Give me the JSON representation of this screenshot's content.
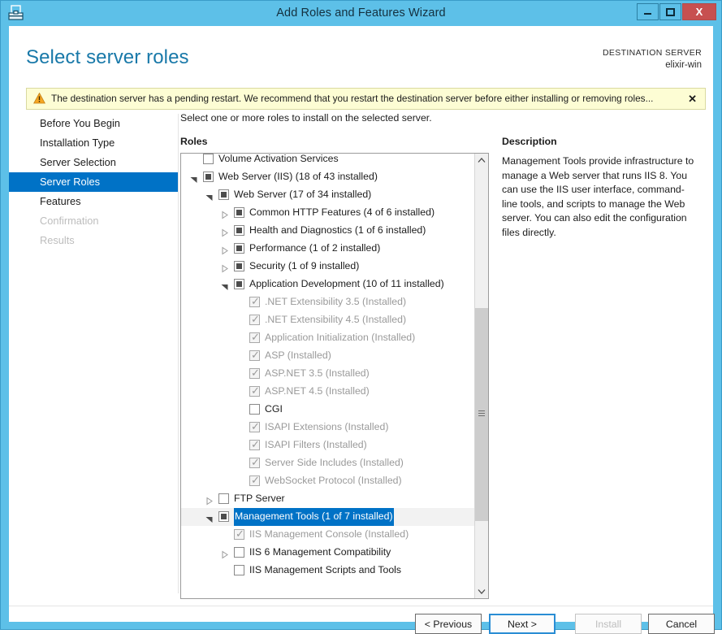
{
  "window": {
    "title": "Add Roles and Features Wizard",
    "icon": "server-manager-toolbox-icon",
    "minimize_label": "",
    "maximize_label": "",
    "close_label": "X",
    "accent_color": "#5dc0e8",
    "close_color": "#c75050"
  },
  "header": {
    "page_title": "Select server roles",
    "destination_label": "DESTINATION SERVER",
    "destination_value": "elixir-win",
    "title_color": "#1979a9"
  },
  "warning": {
    "text": "The destination server has a pending restart. We recommend that you restart the destination server before either installing or removing roles...",
    "close_label": "✕",
    "icon": "warning-triangle-icon",
    "background": "#fdfdd4",
    "border": "#d9d9a0"
  },
  "nav": {
    "items": [
      {
        "label": "Before You Begin",
        "state": "enabled"
      },
      {
        "label": "Installation Type",
        "state": "enabled"
      },
      {
        "label": "Server Selection",
        "state": "enabled"
      },
      {
        "label": "Server Roles",
        "state": "active"
      },
      {
        "label": "Features",
        "state": "enabled"
      },
      {
        "label": "Confirmation",
        "state": "disabled"
      },
      {
        "label": "Results",
        "state": "disabled"
      }
    ],
    "active_color": "#0072c6"
  },
  "main": {
    "instruction": "Select one or more roles to install on the selected server.",
    "roles_label": "Roles",
    "description_label": "Description",
    "description_body": "Management Tools provide infrastructure to manage a Web server that runs IIS 8. You can use the IIS user interface, command-line tools, and scripts to manage the Web server. You can also edit the configuration files directly."
  },
  "tree": {
    "rows": [
      {
        "label": "Volume Activation Services",
        "indent": 0,
        "check": "unchecked",
        "twisty": "none",
        "dim": false,
        "selected": false
      },
      {
        "label": "Web Server (IIS) (18 of 43 installed)",
        "indent": 0,
        "check": "partial",
        "twisty": "expanded",
        "dim": false,
        "selected": false
      },
      {
        "label": "Web Server (17 of 34 installed)",
        "indent": 1,
        "check": "partial",
        "twisty": "expanded",
        "dim": false,
        "selected": false
      },
      {
        "label": "Common HTTP Features (4 of 6 installed)",
        "indent": 2,
        "check": "partial",
        "twisty": "collapsed",
        "dim": false,
        "selected": false
      },
      {
        "label": "Health and Diagnostics (1 of 6 installed)",
        "indent": 2,
        "check": "partial",
        "twisty": "collapsed",
        "dim": false,
        "selected": false
      },
      {
        "label": "Performance (1 of 2 installed)",
        "indent": 2,
        "check": "partial",
        "twisty": "collapsed",
        "dim": false,
        "selected": false
      },
      {
        "label": "Security (1 of 9 installed)",
        "indent": 2,
        "check": "partial",
        "twisty": "collapsed",
        "dim": false,
        "selected": false
      },
      {
        "label": "Application Development (10 of 11 installed)",
        "indent": 2,
        "check": "partial",
        "twisty": "expanded",
        "dim": false,
        "selected": false
      },
      {
        "label": ".NET Extensibility 3.5 (Installed)",
        "indent": 3,
        "check": "checked-gray",
        "twisty": "none",
        "dim": true,
        "selected": false
      },
      {
        "label": ".NET Extensibility 4.5 (Installed)",
        "indent": 3,
        "check": "checked-gray",
        "twisty": "none",
        "dim": true,
        "selected": false
      },
      {
        "label": "Application Initialization (Installed)",
        "indent": 3,
        "check": "checked-gray",
        "twisty": "none",
        "dim": true,
        "selected": false
      },
      {
        "label": "ASP (Installed)",
        "indent": 3,
        "check": "checked-gray",
        "twisty": "none",
        "dim": true,
        "selected": false
      },
      {
        "label": "ASP.NET 3.5 (Installed)",
        "indent": 3,
        "check": "checked-gray",
        "twisty": "none",
        "dim": true,
        "selected": false
      },
      {
        "label": "ASP.NET 4.5 (Installed)",
        "indent": 3,
        "check": "checked-gray",
        "twisty": "none",
        "dim": true,
        "selected": false
      },
      {
        "label": "CGI",
        "indent": 3,
        "check": "unchecked",
        "twisty": "none",
        "dim": false,
        "selected": false
      },
      {
        "label": "ISAPI Extensions (Installed)",
        "indent": 3,
        "check": "checked-gray",
        "twisty": "none",
        "dim": true,
        "selected": false
      },
      {
        "label": "ISAPI Filters (Installed)",
        "indent": 3,
        "check": "checked-gray",
        "twisty": "none",
        "dim": true,
        "selected": false
      },
      {
        "label": "Server Side Includes (Installed)",
        "indent": 3,
        "check": "checked-gray",
        "twisty": "none",
        "dim": true,
        "selected": false
      },
      {
        "label": "WebSocket Protocol (Installed)",
        "indent": 3,
        "check": "checked-gray",
        "twisty": "none",
        "dim": true,
        "selected": false
      },
      {
        "label": "FTP Server",
        "indent": 1,
        "check": "unchecked",
        "twisty": "collapsed",
        "dim": false,
        "selected": false
      },
      {
        "label": "Management Tools (1 of 7 installed)",
        "indent": 1,
        "check": "partial",
        "twisty": "expanded",
        "dim": false,
        "selected": true
      },
      {
        "label": "IIS Management Console (Installed)",
        "indent": 2,
        "check": "checked-gray",
        "twisty": "none",
        "dim": true,
        "selected": false
      },
      {
        "label": "IIS 6 Management Compatibility",
        "indent": 2,
        "check": "unchecked",
        "twisty": "collapsed",
        "dim": false,
        "selected": false
      },
      {
        "label": "IIS Management Scripts and Tools",
        "indent": 2,
        "check": "unchecked",
        "twisty": "none",
        "dim": false,
        "selected": false
      }
    ],
    "selection_color": "#0072c6",
    "scrollbar": {
      "up_icon": "chevron-up-icon",
      "down_icon": "chevron-down-icon",
      "thumb_top_pct": 35,
      "thumb_height_pct": 48
    }
  },
  "footer": {
    "previous_label": "< Previous",
    "next_label": "Next >",
    "install_label": "Install",
    "cancel_label": "Cancel",
    "install_enabled": false,
    "focus_color": "#2a8dd4"
  }
}
